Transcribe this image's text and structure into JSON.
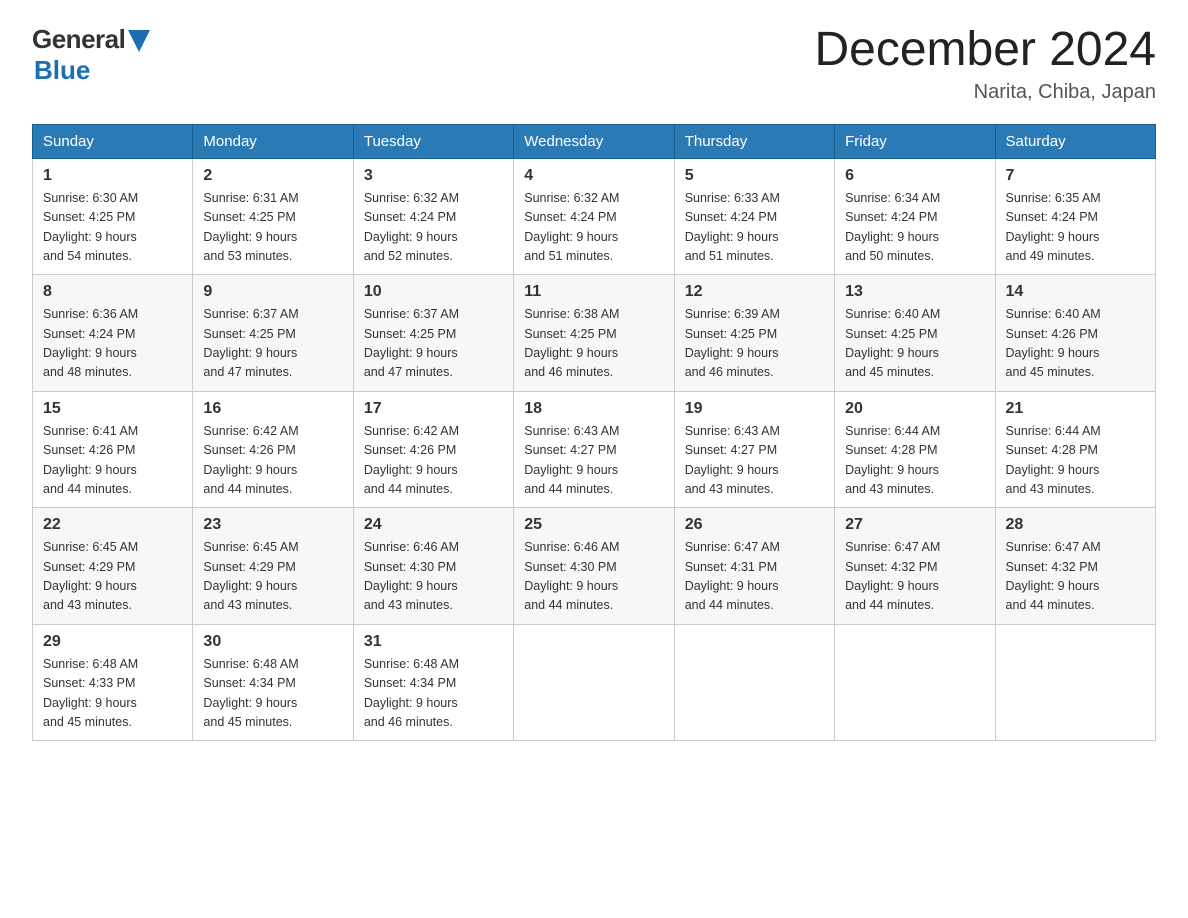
{
  "header": {
    "logo_general": "General",
    "logo_blue": "Blue",
    "month_title": "December 2024",
    "location": "Narita, Chiba, Japan"
  },
  "weekdays": [
    "Sunday",
    "Monday",
    "Tuesday",
    "Wednesday",
    "Thursday",
    "Friday",
    "Saturday"
  ],
  "weeks": [
    [
      {
        "day": "1",
        "sunrise": "Sunrise: 6:30 AM",
        "sunset": "Sunset: 4:25 PM",
        "daylight": "Daylight: 9 hours",
        "daylight2": "and 54 minutes."
      },
      {
        "day": "2",
        "sunrise": "Sunrise: 6:31 AM",
        "sunset": "Sunset: 4:25 PM",
        "daylight": "Daylight: 9 hours",
        "daylight2": "and 53 minutes."
      },
      {
        "day": "3",
        "sunrise": "Sunrise: 6:32 AM",
        "sunset": "Sunset: 4:24 PM",
        "daylight": "Daylight: 9 hours",
        "daylight2": "and 52 minutes."
      },
      {
        "day": "4",
        "sunrise": "Sunrise: 6:32 AM",
        "sunset": "Sunset: 4:24 PM",
        "daylight": "Daylight: 9 hours",
        "daylight2": "and 51 minutes."
      },
      {
        "day": "5",
        "sunrise": "Sunrise: 6:33 AM",
        "sunset": "Sunset: 4:24 PM",
        "daylight": "Daylight: 9 hours",
        "daylight2": "and 51 minutes."
      },
      {
        "day": "6",
        "sunrise": "Sunrise: 6:34 AM",
        "sunset": "Sunset: 4:24 PM",
        "daylight": "Daylight: 9 hours",
        "daylight2": "and 50 minutes."
      },
      {
        "day": "7",
        "sunrise": "Sunrise: 6:35 AM",
        "sunset": "Sunset: 4:24 PM",
        "daylight": "Daylight: 9 hours",
        "daylight2": "and 49 minutes."
      }
    ],
    [
      {
        "day": "8",
        "sunrise": "Sunrise: 6:36 AM",
        "sunset": "Sunset: 4:24 PM",
        "daylight": "Daylight: 9 hours",
        "daylight2": "and 48 minutes."
      },
      {
        "day": "9",
        "sunrise": "Sunrise: 6:37 AM",
        "sunset": "Sunset: 4:25 PM",
        "daylight": "Daylight: 9 hours",
        "daylight2": "and 47 minutes."
      },
      {
        "day": "10",
        "sunrise": "Sunrise: 6:37 AM",
        "sunset": "Sunset: 4:25 PM",
        "daylight": "Daylight: 9 hours",
        "daylight2": "and 47 minutes."
      },
      {
        "day": "11",
        "sunrise": "Sunrise: 6:38 AM",
        "sunset": "Sunset: 4:25 PM",
        "daylight": "Daylight: 9 hours",
        "daylight2": "and 46 minutes."
      },
      {
        "day": "12",
        "sunrise": "Sunrise: 6:39 AM",
        "sunset": "Sunset: 4:25 PM",
        "daylight": "Daylight: 9 hours",
        "daylight2": "and 46 minutes."
      },
      {
        "day": "13",
        "sunrise": "Sunrise: 6:40 AM",
        "sunset": "Sunset: 4:25 PM",
        "daylight": "Daylight: 9 hours",
        "daylight2": "and 45 minutes."
      },
      {
        "day": "14",
        "sunrise": "Sunrise: 6:40 AM",
        "sunset": "Sunset: 4:26 PM",
        "daylight": "Daylight: 9 hours",
        "daylight2": "and 45 minutes."
      }
    ],
    [
      {
        "day": "15",
        "sunrise": "Sunrise: 6:41 AM",
        "sunset": "Sunset: 4:26 PM",
        "daylight": "Daylight: 9 hours",
        "daylight2": "and 44 minutes."
      },
      {
        "day": "16",
        "sunrise": "Sunrise: 6:42 AM",
        "sunset": "Sunset: 4:26 PM",
        "daylight": "Daylight: 9 hours",
        "daylight2": "and 44 minutes."
      },
      {
        "day": "17",
        "sunrise": "Sunrise: 6:42 AM",
        "sunset": "Sunset: 4:26 PM",
        "daylight": "Daylight: 9 hours",
        "daylight2": "and 44 minutes."
      },
      {
        "day": "18",
        "sunrise": "Sunrise: 6:43 AM",
        "sunset": "Sunset: 4:27 PM",
        "daylight": "Daylight: 9 hours",
        "daylight2": "and 44 minutes."
      },
      {
        "day": "19",
        "sunrise": "Sunrise: 6:43 AM",
        "sunset": "Sunset: 4:27 PM",
        "daylight": "Daylight: 9 hours",
        "daylight2": "and 43 minutes."
      },
      {
        "day": "20",
        "sunrise": "Sunrise: 6:44 AM",
        "sunset": "Sunset: 4:28 PM",
        "daylight": "Daylight: 9 hours",
        "daylight2": "and 43 minutes."
      },
      {
        "day": "21",
        "sunrise": "Sunrise: 6:44 AM",
        "sunset": "Sunset: 4:28 PM",
        "daylight": "Daylight: 9 hours",
        "daylight2": "and 43 minutes."
      }
    ],
    [
      {
        "day": "22",
        "sunrise": "Sunrise: 6:45 AM",
        "sunset": "Sunset: 4:29 PM",
        "daylight": "Daylight: 9 hours",
        "daylight2": "and 43 minutes."
      },
      {
        "day": "23",
        "sunrise": "Sunrise: 6:45 AM",
        "sunset": "Sunset: 4:29 PM",
        "daylight": "Daylight: 9 hours",
        "daylight2": "and 43 minutes."
      },
      {
        "day": "24",
        "sunrise": "Sunrise: 6:46 AM",
        "sunset": "Sunset: 4:30 PM",
        "daylight": "Daylight: 9 hours",
        "daylight2": "and 43 minutes."
      },
      {
        "day": "25",
        "sunrise": "Sunrise: 6:46 AM",
        "sunset": "Sunset: 4:30 PM",
        "daylight": "Daylight: 9 hours",
        "daylight2": "and 44 minutes."
      },
      {
        "day": "26",
        "sunrise": "Sunrise: 6:47 AM",
        "sunset": "Sunset: 4:31 PM",
        "daylight": "Daylight: 9 hours",
        "daylight2": "and 44 minutes."
      },
      {
        "day": "27",
        "sunrise": "Sunrise: 6:47 AM",
        "sunset": "Sunset: 4:32 PM",
        "daylight": "Daylight: 9 hours",
        "daylight2": "and 44 minutes."
      },
      {
        "day": "28",
        "sunrise": "Sunrise: 6:47 AM",
        "sunset": "Sunset: 4:32 PM",
        "daylight": "Daylight: 9 hours",
        "daylight2": "and 44 minutes."
      }
    ],
    [
      {
        "day": "29",
        "sunrise": "Sunrise: 6:48 AM",
        "sunset": "Sunset: 4:33 PM",
        "daylight": "Daylight: 9 hours",
        "daylight2": "and 45 minutes."
      },
      {
        "day": "30",
        "sunrise": "Sunrise: 6:48 AM",
        "sunset": "Sunset: 4:34 PM",
        "daylight": "Daylight: 9 hours",
        "daylight2": "and 45 minutes."
      },
      {
        "day": "31",
        "sunrise": "Sunrise: 6:48 AM",
        "sunset": "Sunset: 4:34 PM",
        "daylight": "Daylight: 9 hours",
        "daylight2": "and 46 minutes."
      },
      null,
      null,
      null,
      null
    ]
  ]
}
